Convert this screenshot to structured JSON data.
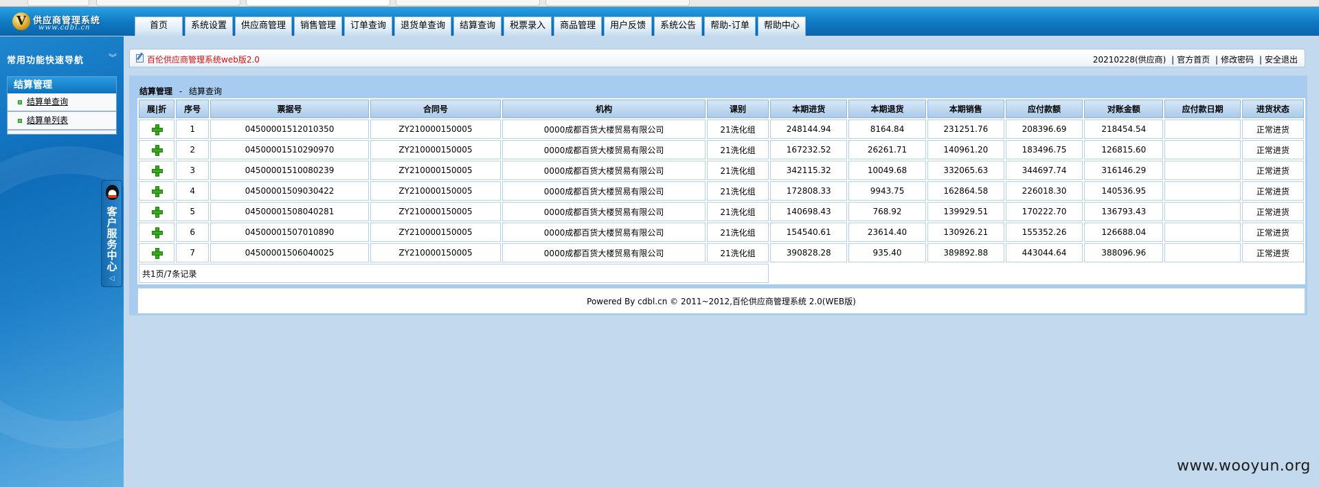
{
  "header": {
    "logo_letter": "V",
    "logo_title": "供应商管理系统",
    "logo_url": "www.cdbl.cn"
  },
  "nav": [
    {
      "label": "首页"
    },
    {
      "label": "系统设置"
    },
    {
      "label": "供应商管理"
    },
    {
      "label": "销售管理"
    },
    {
      "label": "订单查询"
    },
    {
      "label": "退货单查询"
    },
    {
      "label": "结算查询"
    },
    {
      "label": "税票录入"
    },
    {
      "label": "商品管理"
    },
    {
      "label": "用户反馈"
    },
    {
      "label": "系统公告"
    },
    {
      "label": "帮助-订单"
    },
    {
      "label": "帮助中心"
    }
  ],
  "sidebar": {
    "quicknav_title": "常用功能快速导航",
    "quicknav_toggle": "︾",
    "menu_title": "结算管理",
    "items": [
      {
        "label": "结算单查询"
      },
      {
        "label": "结算单列表"
      }
    ],
    "cs_tab": {
      "text": "客户服务中心",
      "arrow": "◁"
    }
  },
  "breadcrumb_bar": {
    "title": "百伦供应商管理系统web版2.0",
    "user": "20210228(供应商)",
    "links": [
      "官方首页",
      "修改密码",
      "安全退出"
    ],
    "separator": "|"
  },
  "page": {
    "section": "结算管理",
    "dash": "-",
    "current": "结算查询"
  },
  "table": {
    "columns": [
      "展|折",
      "序号",
      "票据号",
      "合同号",
      "机构",
      "课别",
      "本期进货",
      "本期退货",
      "本期销售",
      "应付款额",
      "对账金额",
      "应付款日期",
      "进货状态"
    ],
    "rows": [
      {
        "seq": "1",
        "bill": "04500001512010350",
        "contract": "ZY210000150005",
        "org": "0000成都百货大楼贸易有限公司",
        "dept": "21洗化组",
        "purchase": "248144.94",
        "returns": "8164.84",
        "sales": "231251.76",
        "payable": "208396.69",
        "reconcile": "218454.54",
        "due_date": "",
        "status": "正常进货"
      },
      {
        "seq": "2",
        "bill": "04500001510290970",
        "contract": "ZY210000150005",
        "org": "0000成都百货大楼贸易有限公司",
        "dept": "21洗化组",
        "purchase": "167232.52",
        "returns": "26261.71",
        "sales": "140961.20",
        "payable": "183496.75",
        "reconcile": "126815.60",
        "due_date": "",
        "status": "正常进货"
      },
      {
        "seq": "3",
        "bill": "04500001510080239",
        "contract": "ZY210000150005",
        "org": "0000成都百货大楼贸易有限公司",
        "dept": "21洗化组",
        "purchase": "342115.32",
        "returns": "10049.68",
        "sales": "332065.63",
        "payable": "344697.74",
        "reconcile": "316146.29",
        "due_date": "",
        "status": "正常进货"
      },
      {
        "seq": "4",
        "bill": "04500001509030422",
        "contract": "ZY210000150005",
        "org": "0000成都百货大楼贸易有限公司",
        "dept": "21洗化组",
        "purchase": "172808.33",
        "returns": "9943.75",
        "sales": "162864.58",
        "payable": "226018.30",
        "reconcile": "140536.95",
        "due_date": "",
        "status": "正常进货"
      },
      {
        "seq": "5",
        "bill": "04500001508040281",
        "contract": "ZY210000150005",
        "org": "0000成都百货大楼贸易有限公司",
        "dept": "21洗化组",
        "purchase": "140698.43",
        "returns": "768.92",
        "sales": "139929.51",
        "payable": "170222.70",
        "reconcile": "136793.43",
        "due_date": "",
        "status": "正常进货"
      },
      {
        "seq": "6",
        "bill": "04500001507010890",
        "contract": "ZY210000150005",
        "org": "0000成都百货大楼贸易有限公司",
        "dept": "21洗化组",
        "purchase": "154540.61",
        "returns": "23614.40",
        "sales": "130926.21",
        "payable": "155352.26",
        "reconcile": "126688.04",
        "due_date": "",
        "status": "正常进货"
      },
      {
        "seq": "7",
        "bill": "04500001506040025",
        "contract": "ZY210000150005",
        "org": "0000成都百货大楼贸易有限公司",
        "dept": "21洗化组",
        "purchase": "390828.28",
        "returns": "935.40",
        "sales": "389892.88",
        "payable": "443044.64",
        "reconcile": "388096.96",
        "due_date": "",
        "status": "正常进货"
      }
    ],
    "footer": "共1页/7条记录"
  },
  "powered_by": "Powered By cdbl.cn © 2011~2012,百伦供应商管理系统 2.0(WEB版)",
  "watermark": "www.wooyun.org",
  "colors": {
    "header_blue": "#0f79c3",
    "content_bg": "#a8ccef",
    "brand_title_red": "#d01010",
    "plus_green": "#38a81c"
  },
  "icons": {
    "expand": "plus-icon",
    "logo": "logo-v-icon",
    "breadcrumb": "edit-icon",
    "customer_service": "qq-icon"
  }
}
